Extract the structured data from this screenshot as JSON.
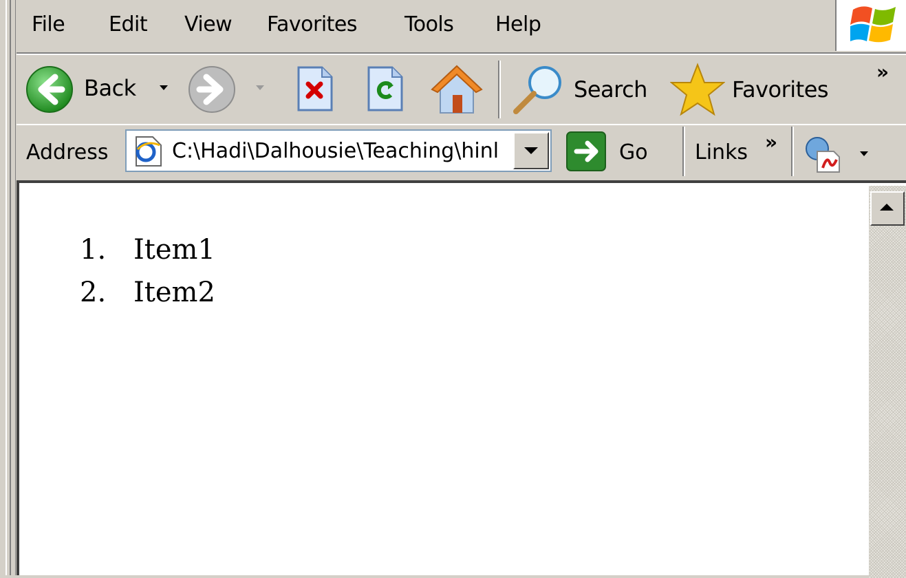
{
  "menu": {
    "file": "File",
    "edit": "Edit",
    "view": "View",
    "favorites": "Favorites",
    "tools": "Tools",
    "help": "Help"
  },
  "toolbar": {
    "back": "Back",
    "search": "Search",
    "favorites": "Favorites",
    "chevron": "»"
  },
  "address": {
    "label": "Address",
    "value": "C:\\Hadi\\Dalhousie\\Teaching\\hinl",
    "go": "Go",
    "links": "Links",
    "links_chevron": "»"
  },
  "page": {
    "list": [
      {
        "num": "1.",
        "text": "Item1"
      },
      {
        "num": "2.",
        "text": "Item2"
      }
    ]
  },
  "colors": {
    "chrome": "#d4d0c8",
    "go_green": "#2e8b2e",
    "back_green": "#3aa63a",
    "star_yellow": "#f5c518"
  }
}
